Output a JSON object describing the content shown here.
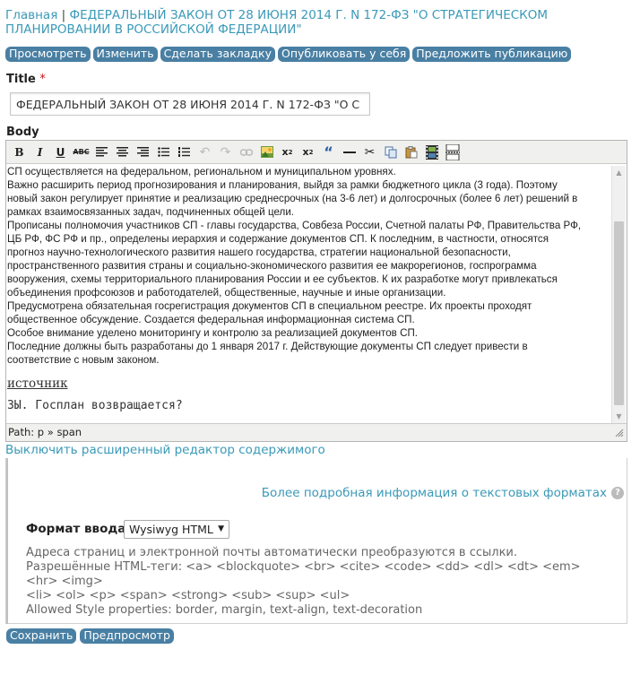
{
  "breadcrumb": {
    "home": "Главная",
    "separator": "|",
    "current": "ФЕДЕРАЛЬНЫЙ ЗАКОН ОТ 28 ИЮНЯ 2014 Г. N 172-ФЗ \"О СТРАТЕГИЧЕСКОМ ПЛАНИРОВАНИИ В РОССИЙСКОЙ ФЕДЕРАЦИИ\""
  },
  "tabs": [
    "Просмотреть",
    "Изменить",
    "Сделать закладку",
    "Опубликовать у себя",
    "Предложить публикацию"
  ],
  "title_field": {
    "label": "Title",
    "required_mark": "*",
    "value": "ФЕДЕРАЛЬНЫЙ ЗАКОН ОТ 28 ИЮНЯ 2014 Г. N 172-ФЗ \"О С"
  },
  "body_field": {
    "label": "Body"
  },
  "toolbar_icons": [
    "bold-icon",
    "italic-icon",
    "underline-icon",
    "strikethrough-icon",
    "align-left-icon",
    "align-center-icon",
    "align-right-icon",
    "bullet-list-icon",
    "numbered-list-icon",
    "undo-icon",
    "redo-icon",
    "link-icon",
    "image-icon",
    "superscript-icon",
    "subscript-icon",
    "blockquote-icon",
    "horizontal-rule-icon",
    "cut-icon",
    "copy-icon",
    "paste-icon",
    "media-icon",
    "page-break-icon"
  ],
  "editor": {
    "paragraph_lines": [
      "СП осуществляется на федеральном, региональном и муниципальном уровнях.",
      "Важно расширить период прогнозирования и планирования, выйдя за рамки бюджетного цикла (3 года). Поэтому",
      "новый закон регулирует принятие и реализацию среднесрочных (на 3-6 лет) и долгосрочных (более 6 лет) решений в",
      "рамках взаимосвязанных задач, подчиненных общей цели.",
      "Прописаны полномочия участников СП - главы государства, Совбеза России, Счетной палаты РФ, Правительства РФ,",
      "ЦБ РФ, ФС РФ и пр., определены иерархия и содержание документов СП. К последним, в частности, относятся",
      "прогноз научно-технологического развития нашего государства, стратегии национальной безопасности,",
      "пространственного развития страны и социально-экономического развития ее макрорегионов, госпрограмма",
      "вооружения, схемы территориального планирования России и ее субъектов. К их разработке могут привлекаться",
      "объединения профсоюзов и работодателей, общественные, научные и иные организации.",
      "Предусмотрена обязательная госрегистрация документов СП в специальном реестре. Их проекты проходят",
      "общественное обсуждение. Создается федеральная информационная система СП.",
      "Особое внимание уделено мониторингу и контролю за реализацией документов СП.",
      "Последние должны быть разработаны до 1 января 2017 г. Действующие документы СП следует привести в",
      "соответствие с новым законом."
    ],
    "source_link": "источник",
    "last_line": "ЗЫ. Госплан возвращается?",
    "status_path": "Path: p » span"
  },
  "toggle_editor_link": "Выключить расширенный редактор содержимого",
  "format": {
    "more_info_link": "Более подробная информация о текстовых форматах",
    "help_glyph": "?",
    "label": "Формат ввода",
    "selected": "Wysiwyg HTML",
    "caret": "▼",
    "tips": [
      "Адреса страниц и электронной почты автоматически преобразуются в ссылки.",
      "Разрешённые HTML-теги: <a> <blockquote> <br> <cite> <code> <dd> <dl> <dt> <em> <hr> <img>",
      "<li> <ol> <p> <span> <strong> <sub> <sup> <ul>",
      "Allowed Style properties: border, margin, text-align, text-decoration"
    ]
  },
  "actions": {
    "save": "Сохранить",
    "preview": "Предпросмотр"
  }
}
